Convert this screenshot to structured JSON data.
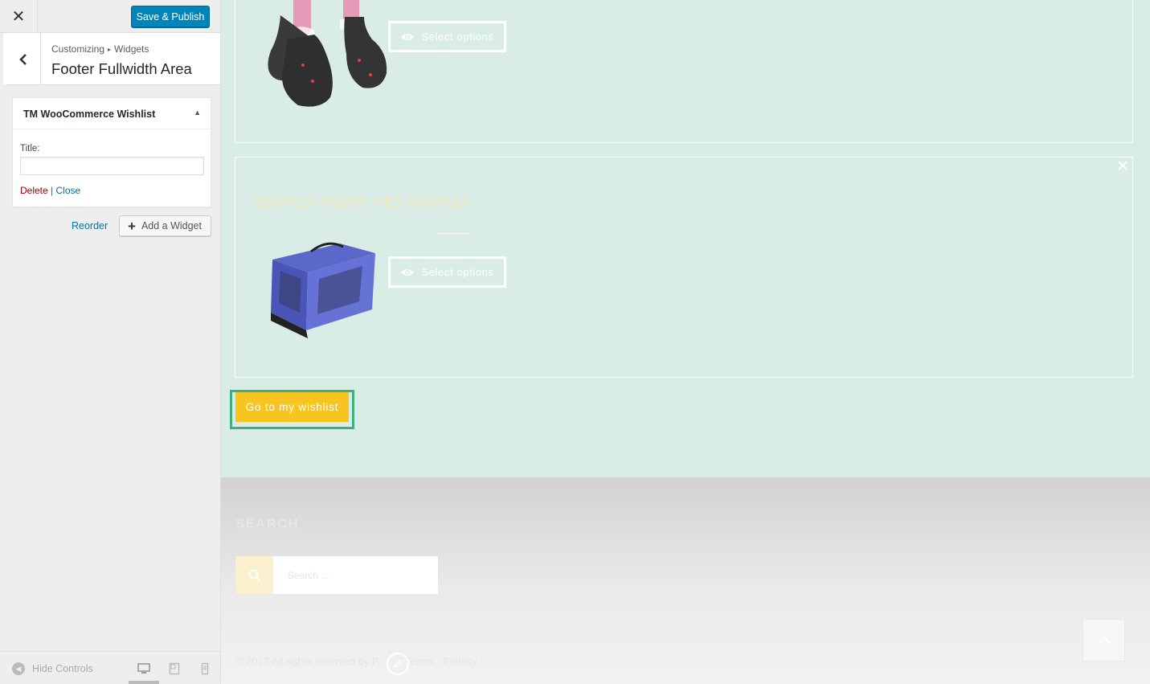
{
  "customizer": {
    "close_icon": "close-icon",
    "save_label": "Save & Publish",
    "breadcrumb": {
      "root": "Customizing",
      "current": "Widgets"
    },
    "section_title": "Footer Fullwidth Area",
    "widget": {
      "title": "TM WooCommerce Wishlist",
      "field_label": "Title:",
      "field_value": "",
      "delete_label": "Delete",
      "separator": "|",
      "close_label": "Close"
    },
    "reorder_label": "Reorder",
    "add_widget_label": "Add a Widget",
    "hide_controls_label": "Hide Controls",
    "devices": [
      "desktop",
      "tablet",
      "mobile"
    ],
    "active_device": "desktop"
  },
  "preview": {
    "products": [
      {
        "title": "",
        "action_label": "Select options"
      },
      {
        "title": "EASIPET FABRIC PET CARRIER",
        "action_label": "Select options"
      }
    ],
    "wishlist_button_label": "Go to my wishlist",
    "footer": {
      "search_heading": "SEARCH",
      "search_placeholder": "Search ...",
      "copyright_prefix": "© 2017 All rights reserved by",
      "brand_partial": "P",
      "separator": "/",
      "terms_label": "Terms",
      "dot": "·",
      "privacy_label": "Privacy"
    }
  },
  "colors": {
    "accent_button": "#0085ba",
    "preview_bg": "#d9ede6",
    "wishlist_button": "#f7c51f",
    "focus_outline": "#3eaf7f",
    "delete_link": "#aa0000",
    "link": "#0073aa"
  }
}
